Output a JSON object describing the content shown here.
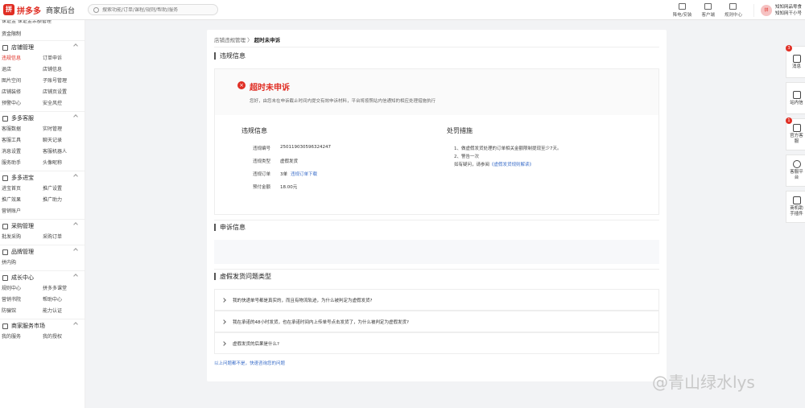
{
  "header": {
    "logo_mark": "拼",
    "logo_text": "拼多多",
    "logo_sub": "商家后台",
    "search_placeholder": "搜索功能/订单/课程/规则/帮助/服务",
    "tools": [
      {
        "label": "降电/安装",
        "icon": "device-icon"
      },
      {
        "label": "客户端",
        "icon": "monitor-icon"
      },
      {
        "label": "规则中心",
        "icon": "rules-icon"
      }
    ],
    "user": {
      "avatar_text": "拼",
      "line1": "知知网品零食",
      "line2": "知知网干小号"
    }
  },
  "sidebar": {
    "cut_text": "保证金    保证金余额管理",
    "solo": "资金限制",
    "groups": [
      {
        "title": "店铺管理",
        "items": [
          "违规信息",
          "订单申诉",
          "退店",
          "店铺信息",
          "图片空间",
          "子账号管理",
          "店铺装修",
          "店铺页设置",
          "预警中心",
          "安全风控"
        ],
        "active": 0
      },
      {
        "title": "多多客服",
        "items": [
          "客服数据",
          "实时管理",
          "客服工具",
          "聊天记录",
          "消息设置",
          "客服机器人",
          "服务助手",
          "头像昵称"
        ],
        "active": -1
      },
      {
        "title": "多多进宝",
        "items": [
          "进宝首页",
          "推广设置",
          "推广效果",
          "推广助力",
          "营销账户"
        ],
        "active": -1
      },
      {
        "title": "采购管理",
        "items": [
          "批发采购",
          "采购订单"
        ],
        "active": -1
      },
      {
        "title": "品牌管理",
        "items": [
          "拼内购"
        ],
        "active": -1
      },
      {
        "title": "成长中心",
        "items": [
          "规则中心",
          "拼多多课堂",
          "营销书院",
          "帮助中心",
          "防骗馆",
          "能力认证"
        ],
        "active": -1
      },
      {
        "title": "商家服务市场",
        "items": [
          "我的服务",
          "我的授权"
        ],
        "active": -1
      }
    ]
  },
  "main": {
    "breadcrumb": {
      "parent": "店铺违规管理",
      "sep": "〉",
      "current": "超时未申诉"
    },
    "section_violation": "违规信息",
    "status": {
      "icon": "×",
      "title": "超时未申诉",
      "desc": "您好，由您未在申诉截止时间内提交有效申诉材料，平台将按照站内信通知的相应处理措施执行"
    },
    "info": {
      "title": "违规信息",
      "rows": [
        {
          "k": "违规编号",
          "v": "2501190305963242​47"
        },
        {
          "k": "违规类型",
          "v": "虚假发货"
        },
        {
          "k": "违规订单",
          "v": "3单",
          "link": "违规订单下载"
        },
        {
          "k": "预付金额",
          "v": "18.00元"
        }
      ]
    },
    "penalty": {
      "title": "处罚措施",
      "line1": "1、做虚假发货处理的订单相关金额限制提现至少7天。",
      "line2": "2、警告一次",
      "line3_prefix": "如有疑问，请参阅",
      "line3_link": "《虚假发货规则解读》"
    },
    "section_appeal": "申诉信息",
    "section_faq": "虚假发货问题类型",
    "faqs": [
      "我的快递单号都是真实的，而且有物流轨迹，为什么被判定为虚假发货?",
      "我在承诺的48小时发货，也在承诺时间内上传单号点击发货了，为什么被判定为虚假发货?",
      "虚假发货的后果是什么?"
    ],
    "help_link": "以上问题都不是，快速咨询您的问题"
  },
  "rail": [
    {
      "label": "消息",
      "badge": "3",
      "icon": "bell-icon"
    },
    {
      "label": "站内信",
      "badge": "",
      "icon": "mail-icon"
    },
    {
      "label": "官方客服",
      "badge": "1",
      "icon": "support-icon"
    },
    {
      "label": "客服平台",
      "badge": "",
      "icon": "chat-icon"
    },
    {
      "label": "商机助手插件",
      "badge": "",
      "icon": "plugin-icon"
    }
  ],
  "watermark": "@青山绿水lys"
}
